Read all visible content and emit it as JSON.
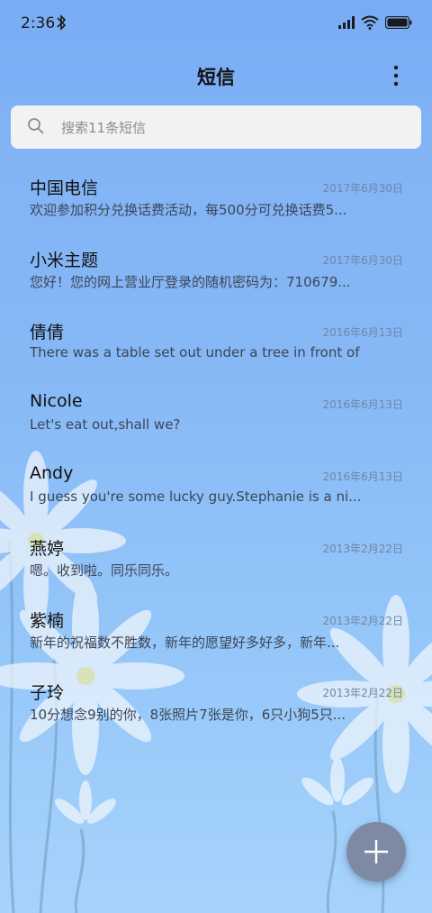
{
  "status_bar": {
    "time": "2:36"
  },
  "header": {
    "title": "短信"
  },
  "search": {
    "placeholder": "搜索11条短信"
  },
  "messages": [
    {
      "name": "中国电信",
      "date": "2017年6月30日",
      "preview": "欢迎参加积分兑换话费活动，每500分可兑换话费5..."
    },
    {
      "name": "小米主题",
      "date": "2017年6月30日",
      "preview": "您好！您的网上营业厅登录的随机密码为：710679..."
    },
    {
      "name": "倩倩",
      "date": "2016年6月13日",
      "preview": "There was a table set out under a tree in front of ..."
    },
    {
      "name": "Nicole",
      "date": "2016年6月13日",
      "preview": "Let's eat out,shall we?"
    },
    {
      "name": "Andy",
      "date": "2016年6月13日",
      "preview": "I guess you're some lucky guy.Stephanie is a ni..."
    },
    {
      "name": "燕婷",
      "date": "2013年2月22日",
      "preview": "嗯。收到啦。同乐同乐。"
    },
    {
      "name": "紫楠",
      "date": "2013年2月22日",
      "preview": "新年的祝福数不胜数，新年的愿望好多好多，新年..."
    },
    {
      "name": "子玲",
      "date": "2013年2月22日",
      "preview": "10分想念9别的你，8张照片7张是你，6只小狗5只..."
    }
  ],
  "colors": {
    "accent": "#7eb0f5",
    "fab": "#7e8aa4"
  }
}
